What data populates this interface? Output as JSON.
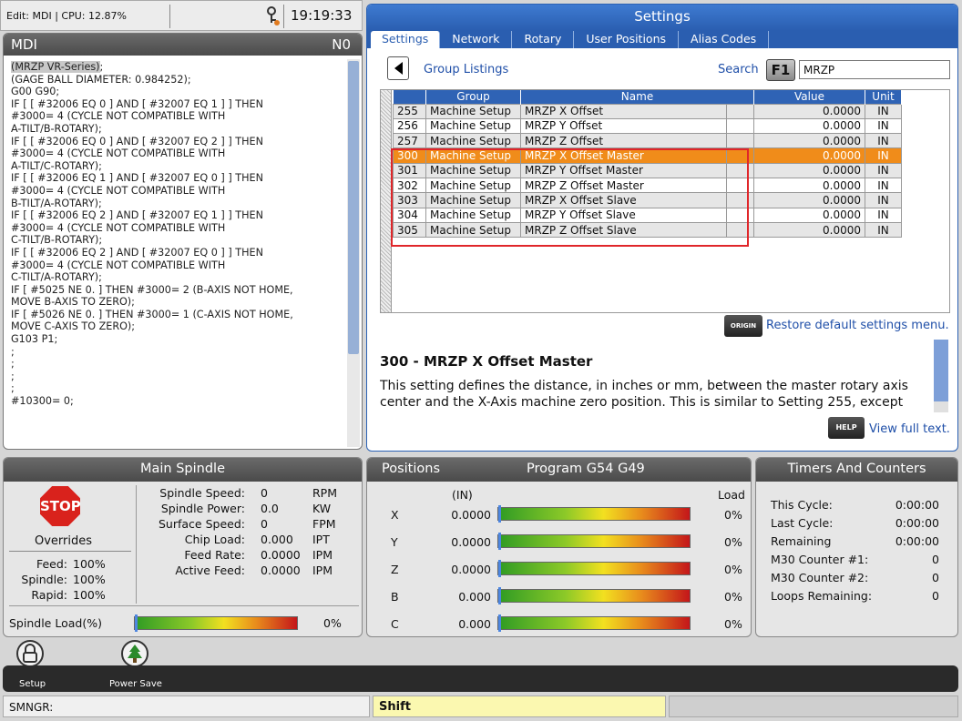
{
  "topbar": {
    "mode": "Edit: MDI | CPU: 12.87%",
    "clock": "19:19:33"
  },
  "mdi": {
    "title": "MDI",
    "n": "N0",
    "first_line": "(MRZP VR-Series)",
    "first_line_tail": ";",
    "lines": [
      "(GAGE BALL DIAMETER: 0.984252);",
      "G00 G90;",
      "IF [ [ #32006 EQ 0 ] AND [ #32007 EQ 1 ] ] THEN",
      "#3000= 4 (CYCLE NOT COMPATIBLE WITH",
      "A-TILT/B-ROTARY);",
      "IF [ [ #32006 EQ 0 ] AND [ #32007 EQ 2 ] ] THEN",
      "#3000= 4 (CYCLE NOT COMPATIBLE WITH",
      "A-TILT/C-ROTARY);",
      "IF [ [ #32006 EQ 1 ] AND [ #32007 EQ 0 ] ] THEN",
      "#3000= 4 (CYCLE NOT COMPATIBLE WITH",
      "B-TILT/A-ROTARY);",
      "IF [ [ #32006 EQ 2 ] AND [ #32007 EQ 1 ] ] THEN",
      "#3000= 4 (CYCLE NOT COMPATIBLE WITH",
      "C-TILT/B-ROTARY);",
      "IF [ [ #32006 EQ 2 ] AND [ #32007 EQ 0 ] ] THEN",
      "#3000= 4 (CYCLE NOT COMPATIBLE WITH",
      "C-TILT/A-ROTARY);",
      "IF [ #5025 NE 0. ] THEN #3000= 2 (B-AXIS NOT HOME,",
      "MOVE B-AXIS TO ZERO);",
      "IF [ #5026 NE 0. ] THEN #3000= 1 (C-AXIS NOT HOME,",
      "MOVE C-AXIS TO ZERO);",
      "G103 P1;",
      ";",
      ";",
      ";",
      ";",
      "#10300= 0;"
    ]
  },
  "settings": {
    "title": "Settings",
    "tabs": [
      "Settings",
      "Network",
      "Rotary",
      "User Positions",
      "Alias Codes"
    ],
    "active_tab": "Settings",
    "group_listings": "Group Listings",
    "search_label": "Search",
    "f1": "F1",
    "search_value": "MRZP",
    "columns": [
      "Group",
      "Name",
      "Value",
      "Unit"
    ],
    "rows": [
      {
        "num": "255",
        "group": "Machine Setup",
        "name": "MRZP X Offset",
        "value": "0.0000",
        "unit": "IN"
      },
      {
        "num": "256",
        "group": "Machine Setup",
        "name": "MRZP Y Offset",
        "value": "0.0000",
        "unit": "IN"
      },
      {
        "num": "257",
        "group": "Machine Setup",
        "name": "MRZP Z Offset",
        "value": "0.0000",
        "unit": "IN"
      },
      {
        "num": "300",
        "group": "Machine Setup",
        "name": "MRZP X Offset Master",
        "value": "0.0000",
        "unit": "IN"
      },
      {
        "num": "301",
        "group": "Machine Setup",
        "name": "MRZP Y Offset Master",
        "value": "0.0000",
        "unit": "IN"
      },
      {
        "num": "302",
        "group": "Machine Setup",
        "name": "MRZP Z Offset Master",
        "value": "0.0000",
        "unit": "IN"
      },
      {
        "num": "303",
        "group": "Machine Setup",
        "name": "MRZP X Offset Slave",
        "value": "0.0000",
        "unit": "IN"
      },
      {
        "num": "304",
        "group": "Machine Setup",
        "name": "MRZP Y Offset Slave",
        "value": "0.0000",
        "unit": "IN"
      },
      {
        "num": "305",
        "group": "Machine Setup",
        "name": "MRZP Z Offset Slave",
        "value": "0.0000",
        "unit": "IN"
      }
    ],
    "selected_row": "300",
    "origin_key": "ORIGIN",
    "restore": "Restore default settings menu.",
    "desc_title": "300 - MRZP X Offset Master",
    "desc_text": "This setting defines the distance, in inches or mm, between the master rotary axis center and the X-Axis machine zero position. This is similar to Setting 255, except",
    "help_key": "HELP",
    "view_full": "View full text.",
    "accent": "#2a5eb0",
    "highlight": "#f08c1a"
  },
  "spindle": {
    "title": "Main Spindle",
    "stop": "STOP",
    "overrides": "Overrides",
    "feed_label": "Feed:",
    "feed": "100%",
    "spindle_label": "Spindle:",
    "spindle": "100%",
    "rapid_label": "Rapid:",
    "rapid": "100%",
    "stats": [
      {
        "label": "Spindle Speed:",
        "value": "0",
        "unit": "RPM"
      },
      {
        "label": "Spindle Power:",
        "value": "0.0",
        "unit": "KW"
      },
      {
        "label": "Surface Speed:",
        "value": "0",
        "unit": "FPM"
      },
      {
        "label": "Chip Load:",
        "value": "0.000",
        "unit": "IPT"
      },
      {
        "label": "Feed Rate:",
        "value": "0.0000",
        "unit": "IPM"
      },
      {
        "label": "Active Feed:",
        "value": "0.0000",
        "unit": "IPM"
      }
    ],
    "load_label": "Spindle Load(%)",
    "load": "0%"
  },
  "positions": {
    "title": "Positions",
    "program": "Program G54 G49",
    "unit": "(IN)",
    "load_header": "Load",
    "axes": [
      {
        "axis": "X",
        "value": "0.0000",
        "load": "0%"
      },
      {
        "axis": "Y",
        "value": "0.0000",
        "load": "0%"
      },
      {
        "axis": "Z",
        "value": "0.0000",
        "load": "0%"
      },
      {
        "axis": "B",
        "value": "0.000",
        "load": "0%"
      },
      {
        "axis": "C",
        "value": "0.000",
        "load": "0%"
      }
    ]
  },
  "timers": {
    "title": "Timers And Counters",
    "rows": [
      {
        "label": "This Cycle:",
        "value": "0:00:00"
      },
      {
        "label": "Last Cycle:",
        "value": "0:00:00"
      },
      {
        "label": "Remaining",
        "value": "0:00:00"
      },
      {
        "label": "M30 Counter #1:",
        "value": "0"
      },
      {
        "label": "M30 Counter #2:",
        "value": "0"
      },
      {
        "label": "Loops Remaining:",
        "value": "0"
      }
    ]
  },
  "dock": {
    "setup": "Setup",
    "power_save": "Power Save",
    "setup_icon": "lock-icon",
    "power_icon": "tree-icon"
  },
  "status": {
    "left": "SMNGR:",
    "shift": "Shift"
  }
}
